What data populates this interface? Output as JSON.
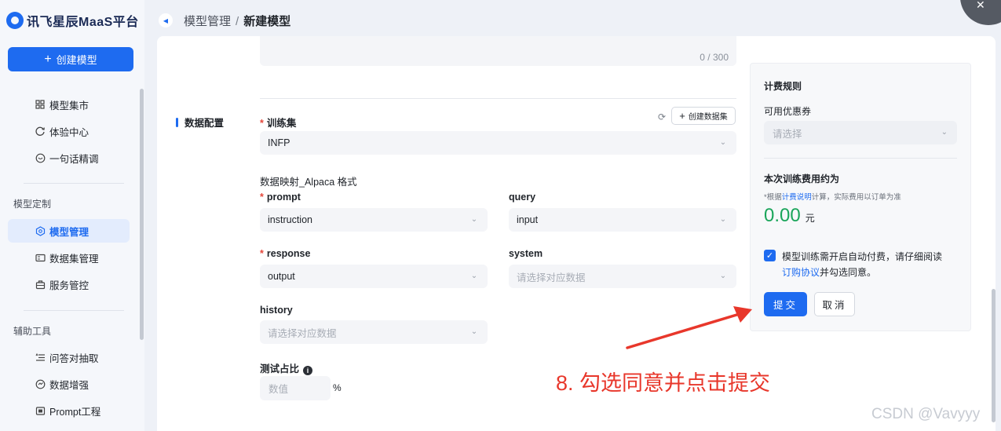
{
  "app": {
    "logo_text": "讯飞星辰MaaS平台"
  },
  "sidebar": {
    "create_label": "创建模型",
    "items_top": [
      {
        "label": "模型集市",
        "icon": "grid-icon"
      },
      {
        "label": "体验中心",
        "icon": "loop-icon"
      },
      {
        "label": "一句话精调",
        "icon": "chat-icon"
      }
    ],
    "group1": "模型定制",
    "items_custom": [
      {
        "label": "模型管理",
        "icon": "model-icon",
        "active": true
      },
      {
        "label": "数据集管理",
        "icon": "dataset-icon"
      },
      {
        "label": "服务管控",
        "icon": "service-icon"
      }
    ],
    "group2": "辅助工具",
    "items_tools": [
      {
        "label": "问答对抽取",
        "icon": "list-icon"
      },
      {
        "label": "数据增强",
        "icon": "enhance-icon"
      },
      {
        "label": "Prompt工程",
        "icon": "prompt-icon"
      }
    ]
  },
  "header": {
    "crumb_parent": "模型管理",
    "crumb_sep": "/",
    "crumb_current": "新建模型"
  },
  "form": {
    "char_count": "0 / 300",
    "section_title": "数据配置",
    "train_set_label": "训练集",
    "train_set_value": "INFP",
    "create_dataset_label": "创建数据集",
    "mapping_title": "数据映射_Alpaca 格式",
    "prompt_label": "prompt",
    "prompt_value": "instruction",
    "query_label": "query",
    "query_value": "input",
    "response_label": "response",
    "response_value": "output",
    "system_label": "system",
    "system_placeholder": "请选择对应数据",
    "history_label": "history",
    "history_placeholder": "请选择对应数据",
    "ratio_label": "测试占比",
    "ratio_placeholder": "数值",
    "ratio_unit": "%"
  },
  "billing": {
    "title": "计费规则",
    "coupon_label": "可用优惠券",
    "coupon_placeholder": "请选择",
    "cost_label": "本次训练费用约为",
    "note_prefix": "*根据",
    "note_link": "计费说明",
    "note_suffix": "计算，实际费用以订单为准",
    "price": "0.00",
    "price_unit": "元",
    "agree_text": "模型训练需开启自动付费，请仔细阅读",
    "agree_link": "订购协议",
    "agree_suffix": "并勾选同意。",
    "submit_label": "提交",
    "cancel_label": "取消"
  },
  "annotation": "8. 勾选同意并点击提交",
  "watermark": "CSDN @Vavyyy",
  "colors": {
    "primary": "#1e6bf0",
    "price": "#1aa55a",
    "annotation": "#e8372b"
  }
}
